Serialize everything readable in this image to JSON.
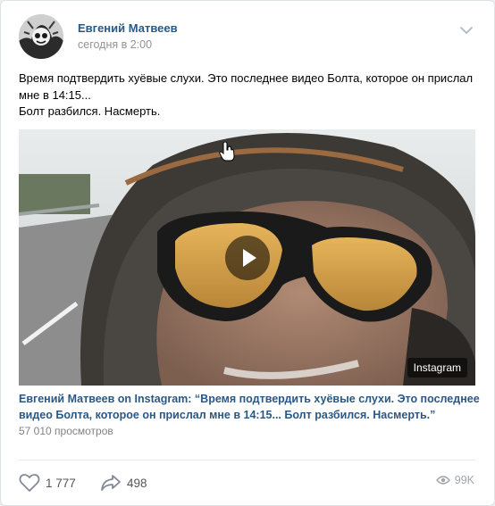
{
  "post": {
    "author": "Евгений Матвеев",
    "time": "сегодня в 2:00",
    "text_lines": [
      "Время подтвердить хуёвые слухи. Это последнее видео Болта, которое он прислал",
      "мне в 14:15...",
      "Болт разбился. Насмерть."
    ]
  },
  "video": {
    "source_badge": "Instagram",
    "title_lines": [
      "Евгений Матвеев on Instagram: “Время подтвердить хуёвые слухи. Это последнее",
      "видео Болта, которое он прислал мне в 14:15... Болт разбился. Насмерть.”"
    ],
    "views": "57 010 просмотров"
  },
  "footer": {
    "likes": "1 777",
    "shares": "498",
    "views": "99K"
  },
  "icons": {
    "menu": "chevron-down-icon",
    "like": "heart-icon",
    "share": "share-arrow-icon",
    "views": "eye-icon",
    "play": "play-icon"
  },
  "colors": {
    "link": "#2a5885",
    "secondary": "#939393",
    "icon": "#828a99"
  }
}
